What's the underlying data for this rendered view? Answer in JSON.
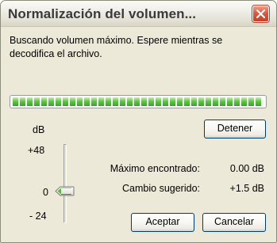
{
  "window": {
    "title": "Normalización del volumen..."
  },
  "message": "Buscando volumen máximo. Espere mientras se decodifica el archivo.",
  "progress": {
    "fraction": 1.0,
    "segment_color": "#3aa423"
  },
  "buttons": {
    "stop_label": "Detener",
    "ok_label": "Aceptar",
    "cancel_label": "Cancelar"
  },
  "slider": {
    "unit": "dB",
    "max_label": "+48",
    "zero_label": "0",
    "min_label": "- 24",
    "value_db": 0
  },
  "stats": {
    "max_found_label": "Máximo encontrado:",
    "max_found_value": "0.00 dB",
    "suggested_label": "Cambio sugerido:",
    "suggested_value": "+1.5 dB"
  },
  "icons": {
    "close": "close-icon",
    "slider_thumb": "slider-thumb-icon"
  },
  "colors": {
    "close_button": "#d9512f",
    "button_border": "#003c74",
    "dialog_background": "#ece9d8",
    "slider_thumb": "#5fb544"
  }
}
